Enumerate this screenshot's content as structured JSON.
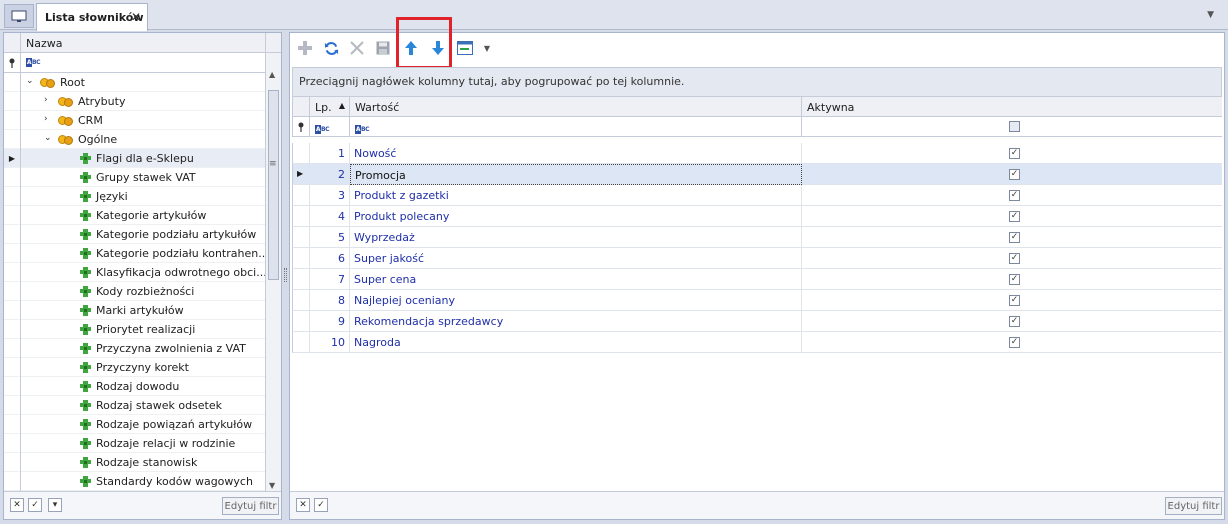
{
  "tab": {
    "title": "Lista słowników",
    "close": "✕"
  },
  "left": {
    "header": "Nazwa",
    "filter_abc": "BC",
    "tree": [
      {
        "label": "Root",
        "type": "folder",
        "level": 0,
        "expanded": true
      },
      {
        "label": "Atrybuty",
        "type": "folder",
        "level": 1,
        "expanded": false
      },
      {
        "label": "CRM",
        "type": "folder",
        "level": 1,
        "expanded": false
      },
      {
        "label": "Ogólne",
        "type": "folder",
        "level": 1,
        "expanded": true
      },
      {
        "label": "Flagi dla e-Sklepu",
        "type": "leaf",
        "level": 2,
        "selected": true
      },
      {
        "label": "Grupy stawek VAT",
        "type": "leaf",
        "level": 2
      },
      {
        "label": "Języki",
        "type": "leaf",
        "level": 2
      },
      {
        "label": "Kategorie artykułów",
        "type": "leaf",
        "level": 2
      },
      {
        "label": "Kategorie podziału artykułów",
        "type": "leaf",
        "level": 2
      },
      {
        "label": "Kategorie podziału kontrahen...",
        "type": "leaf",
        "level": 2
      },
      {
        "label": "Klasyfikacja odwrotnego obci...",
        "type": "leaf",
        "level": 2
      },
      {
        "label": "Kody rozbieżności",
        "type": "leaf",
        "level": 2
      },
      {
        "label": "Marki artykułów",
        "type": "leaf",
        "level": 2
      },
      {
        "label": "Priorytet realizacji",
        "type": "leaf",
        "level": 2
      },
      {
        "label": "Przyczyna zwolnienia z VAT",
        "type": "leaf",
        "level": 2
      },
      {
        "label": "Przyczyny korekt",
        "type": "leaf",
        "level": 2
      },
      {
        "label": "Rodzaj dowodu",
        "type": "leaf",
        "level": 2
      },
      {
        "label": "Rodzaj stawek odsetek",
        "type": "leaf",
        "level": 2
      },
      {
        "label": "Rodzaje powiązań artykułów",
        "type": "leaf",
        "level": 2
      },
      {
        "label": "Rodzaje relacji w rodzinie",
        "type": "leaf",
        "level": 2
      },
      {
        "label": "Rodzaje stanowisk",
        "type": "leaf",
        "level": 2
      },
      {
        "label": "Standardy kodów wagowych",
        "type": "leaf",
        "level": 2
      }
    ],
    "edit_filter": "Edytuj filtr"
  },
  "toolbar": {
    "icons": [
      "add-icon",
      "refresh-icon",
      "delete-icon",
      "save-icon",
      "move-up-icon",
      "move-down-icon",
      "view-options-icon"
    ],
    "colors": {
      "move": "#2a86d8",
      "disabled": "#b5b9c2",
      "refresh": "#2b6fd1",
      "highlight": "#e0222b"
    }
  },
  "grid": {
    "group_hint": "Przeciągnij nagłówek kolumny tutaj, aby pogrupować po tej kolumnie.",
    "columns": {
      "lp": "Lp.",
      "value": "Wartość",
      "active": "Aktywna"
    },
    "rows": [
      {
        "lp": "1",
        "value": "Nowość",
        "active": true
      },
      {
        "lp": "2",
        "value": "Promocja",
        "active": true,
        "selected": true
      },
      {
        "lp": "3",
        "value": "Produkt z gazetki",
        "active": true
      },
      {
        "lp": "4",
        "value": "Produkt polecany",
        "active": true
      },
      {
        "lp": "5",
        "value": "Wyprzedaż",
        "active": true
      },
      {
        "lp": "6",
        "value": "Super jakość",
        "active": true
      },
      {
        "lp": "7",
        "value": "Super cena",
        "active": true
      },
      {
        "lp": "8",
        "value": "Najlepiej oceniany",
        "active": true
      },
      {
        "lp": "9",
        "value": "Rekomendacja sprzedawcy",
        "active": true
      },
      {
        "lp": "10",
        "value": "Nagroda",
        "active": true
      }
    ],
    "edit_filter": "Edytuj filtr"
  }
}
